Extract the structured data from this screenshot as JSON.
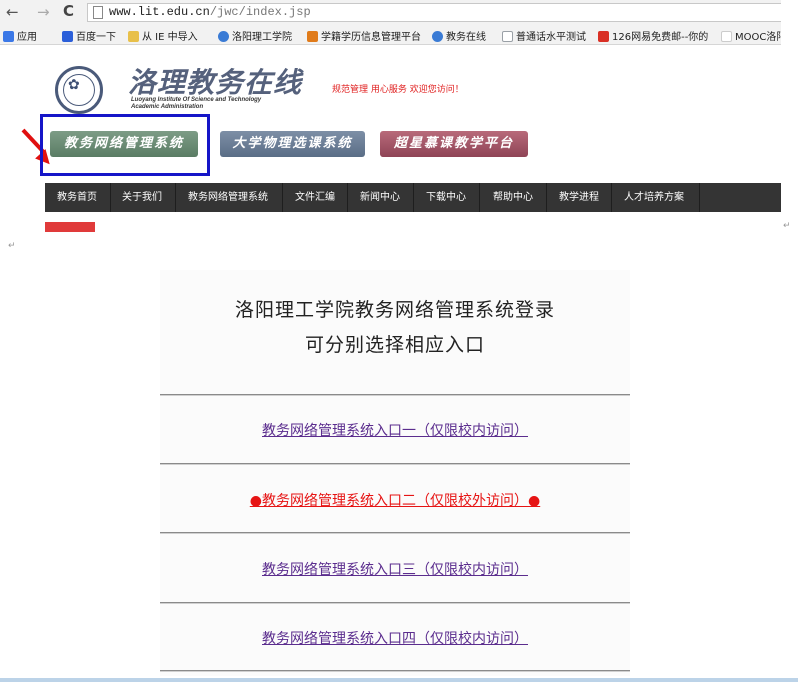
{
  "browser": {
    "back_icon": "←",
    "forward_icon": "→",
    "reload_icon": "C",
    "url_host": "www.lit.edu.cn",
    "url_path": "/jwc/index.jsp",
    "bookmarks": [
      {
        "label": "应用",
        "icon": "apps-icon",
        "color": "#3b78e7"
      },
      {
        "label": "百度一下",
        "icon": "baidu-icon",
        "color": "#2b5fd9"
      },
      {
        "label": "从 IE 中导入",
        "icon": "folder-icon",
        "color": "#e8c04a"
      },
      {
        "label": "洛阳理工学院",
        "icon": "school-icon",
        "color": "#3a7bd5"
      },
      {
        "label": "学籍学历信息管理平台",
        "icon": "chsi-icon",
        "color": "#e07b1a"
      },
      {
        "label": "教务在线",
        "icon": "school-icon",
        "color": "#3a7bd5"
      },
      {
        "label": "普通话水平测试",
        "icon": "page-icon",
        "color": "#9aa0a6"
      },
      {
        "label": "126网易免费邮--你的",
        "icon": "mail-icon",
        "color": "#d93025"
      },
      {
        "label": "MOOC洛阳理",
        "icon": "page-icon",
        "color": "#ffffff"
      }
    ]
  },
  "site": {
    "title": "洛理教务在线",
    "subtitle_line1": "Luoyang Institute Of Science and Technology",
    "subtitle_line2": "Academic Administration",
    "slogan": "规范管理 用心服务 欢迎您访问！",
    "buttons": {
      "edu": "教务网络管理系统",
      "physics": "大学物理选课系统",
      "mooc": "超星慕课教学平台"
    },
    "menu": [
      "教务首页",
      "关于我们",
      "教务网络管理系统",
      "文件汇编",
      "新闻中心",
      "下载中心",
      "帮助中心",
      "教学进程",
      "人才培养方案"
    ],
    "colors": {
      "menubar": "#343434",
      "highlight": "#1515c8",
      "arrow": "#e01010"
    }
  },
  "login": {
    "title_line1": "洛阳理工学院教务网络管理系统登录",
    "title_line2": "可分别选择相应入口",
    "entries": [
      {
        "label": "教务网络管理系统入口一（仅限校内访问）",
        "highlight": false
      },
      {
        "label": "●教务网络管理系统入口二（仅限校外访问）●",
        "highlight": true
      },
      {
        "label": "教务网络管理系统入口三（仅限校内访问）",
        "highlight": false
      },
      {
        "label": "教务网络管理系统入口四（仅限校内访问）",
        "highlight": false
      }
    ],
    "colors": {
      "link": "#5b2d8e",
      "hot_link": "#e61414"
    }
  },
  "marks": {
    "pilcrow": "↵"
  }
}
